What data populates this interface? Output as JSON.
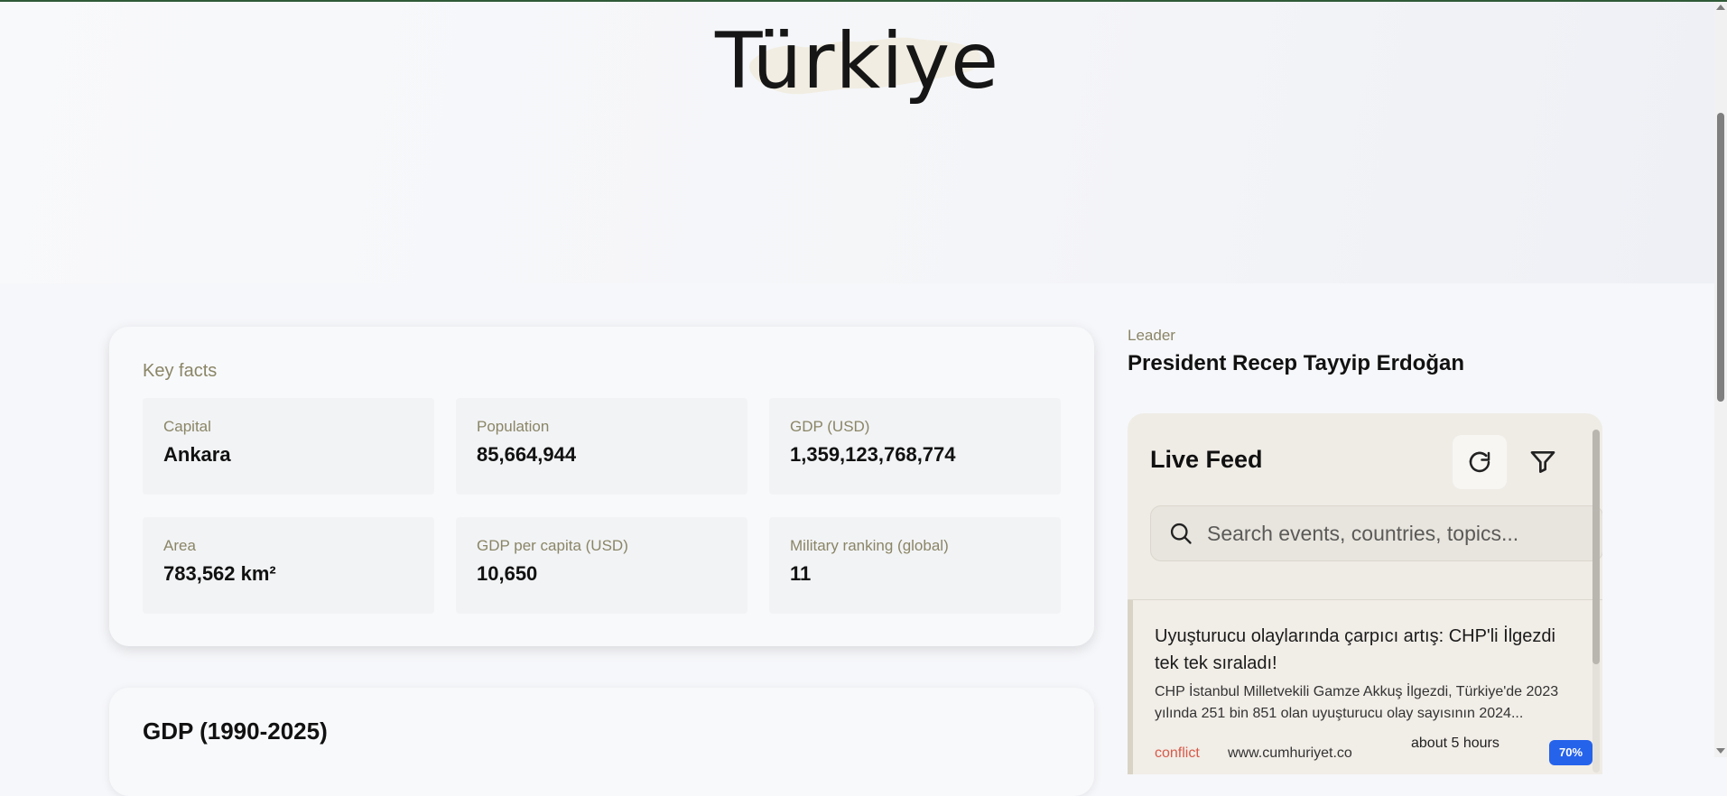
{
  "hero": {
    "title": "Türkiye"
  },
  "key_facts": {
    "title": "Key facts",
    "items": [
      {
        "label": "Capital",
        "value": "Ankara"
      },
      {
        "label": "Population",
        "value": "85,664,944"
      },
      {
        "label": "GDP (USD)",
        "value": "1,359,123,768,774"
      },
      {
        "label": "Area",
        "value": "783,562 km²"
      },
      {
        "label": "GDP per capita (USD)",
        "value": "10,650"
      },
      {
        "label": "Military ranking (global)",
        "value": "11"
      }
    ]
  },
  "gdp": {
    "title": "GDP (1990-2025)"
  },
  "leader": {
    "label": "Leader",
    "name": "President Recep Tayyip Erdoğan"
  },
  "live_feed": {
    "title": "Live Feed",
    "search_placeholder": "Search events, countries, topics...",
    "news": {
      "title": "Uyuşturucu olaylarında çarpıcı artış: CHP'li İlgezdi tek tek sıraladı!",
      "text": "CHP İstanbul Milletvekili Gamze Akkuş İlgezdi, Türkiye'de 2023 yılında 251 bin 851 olan uyuşturucu olay sayısının 2024...",
      "tag": "conflict",
      "source": "www.cumhuriyet.co",
      "time": "about 5 hours",
      "badge": "70%"
    }
  },
  "icons": {
    "refresh": "refresh-icon",
    "filter": "filter-icon",
    "search": "search-icon"
  },
  "colors": {
    "accent_line": "#2f5a37",
    "muted_label": "#8a8566",
    "badge": "#2563eb",
    "tag": "#d75a4a"
  }
}
